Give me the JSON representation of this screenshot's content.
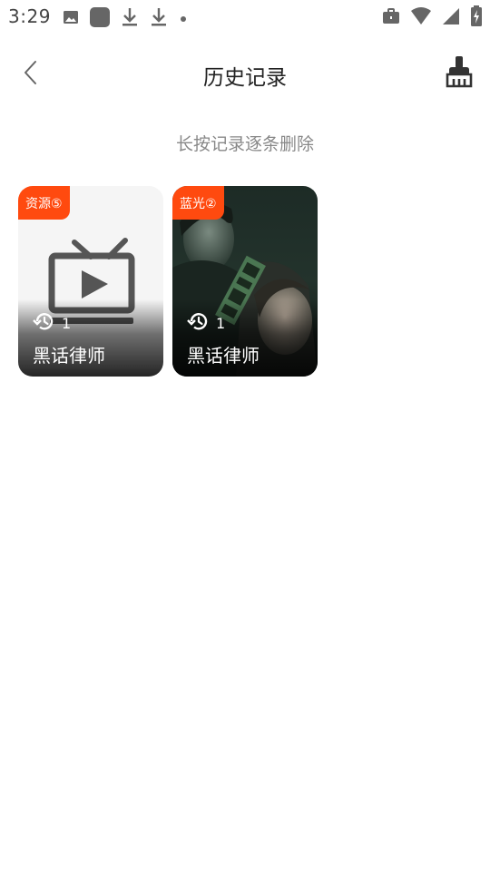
{
  "status_bar": {
    "time": "3:29",
    "left_icons": [
      "image-icon",
      "app-square-icon",
      "download-icon",
      "download-icon",
      "dot-icon"
    ],
    "right_icons": [
      "briefcase-icon",
      "wifi-icon",
      "signal-icon",
      "battery-charging-icon"
    ]
  },
  "header": {
    "title": "历史记录",
    "back_icon": "chevron-left-icon",
    "clear_icon": "broom-icon"
  },
  "hint": "长按记录逐条删除",
  "colors": {
    "accent": "#ff4a0f",
    "title_text": "#222222",
    "hint_text": "#888888"
  },
  "history": [
    {
      "badge": "资源⑤",
      "watch_count": "1",
      "title": "黑话律师",
      "poster": "placeholder-tv"
    },
    {
      "badge": "蓝光②",
      "watch_count": "1",
      "title": "黑话律师",
      "poster": "drama-poster"
    }
  ]
}
